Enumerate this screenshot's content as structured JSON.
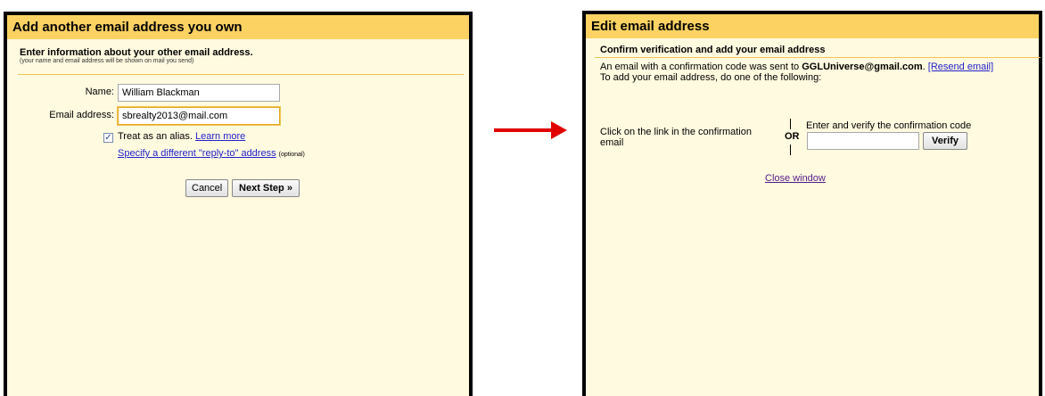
{
  "left_dialog": {
    "title": "Add another email address you own",
    "subtitle": "Enter information about your other email address.",
    "hint": "(your name and email address will be shown on mail you send)",
    "name_label": "Name:",
    "name_value": "William Blackman",
    "email_label": "Email address:",
    "email_value": "sbrealty2013@mail.com",
    "alias_checked": true,
    "alias_label": "Treat as an alias.",
    "learn_more": "Learn more",
    "reply_to_link": "Specify a different \"reply-to\" address",
    "reply_to_optional": "(optional)",
    "cancel_label": "Cancel",
    "next_label": "Next Step »"
  },
  "right_dialog": {
    "title": "Edit email address",
    "subtitle": "Confirm verification and add your email address",
    "sent_text": "An email with a confirmation code was sent to",
    "email": "GGLUniverse@gmail.com",
    "period": ".",
    "resend": "[Resend email]",
    "instruction": "To add your email address, do one of the following:",
    "click_link_text": "Click on the link in the confirmation email",
    "or": "OR",
    "enter_code_text": "Enter and verify the confirmation code",
    "code_value": "",
    "verify_label": "Verify",
    "close_link": "Close window"
  },
  "colors": {
    "title_bar": "#fcd263",
    "panel_bg": "#fffae0",
    "arrow": "#e00000",
    "link": "#2222cc"
  }
}
